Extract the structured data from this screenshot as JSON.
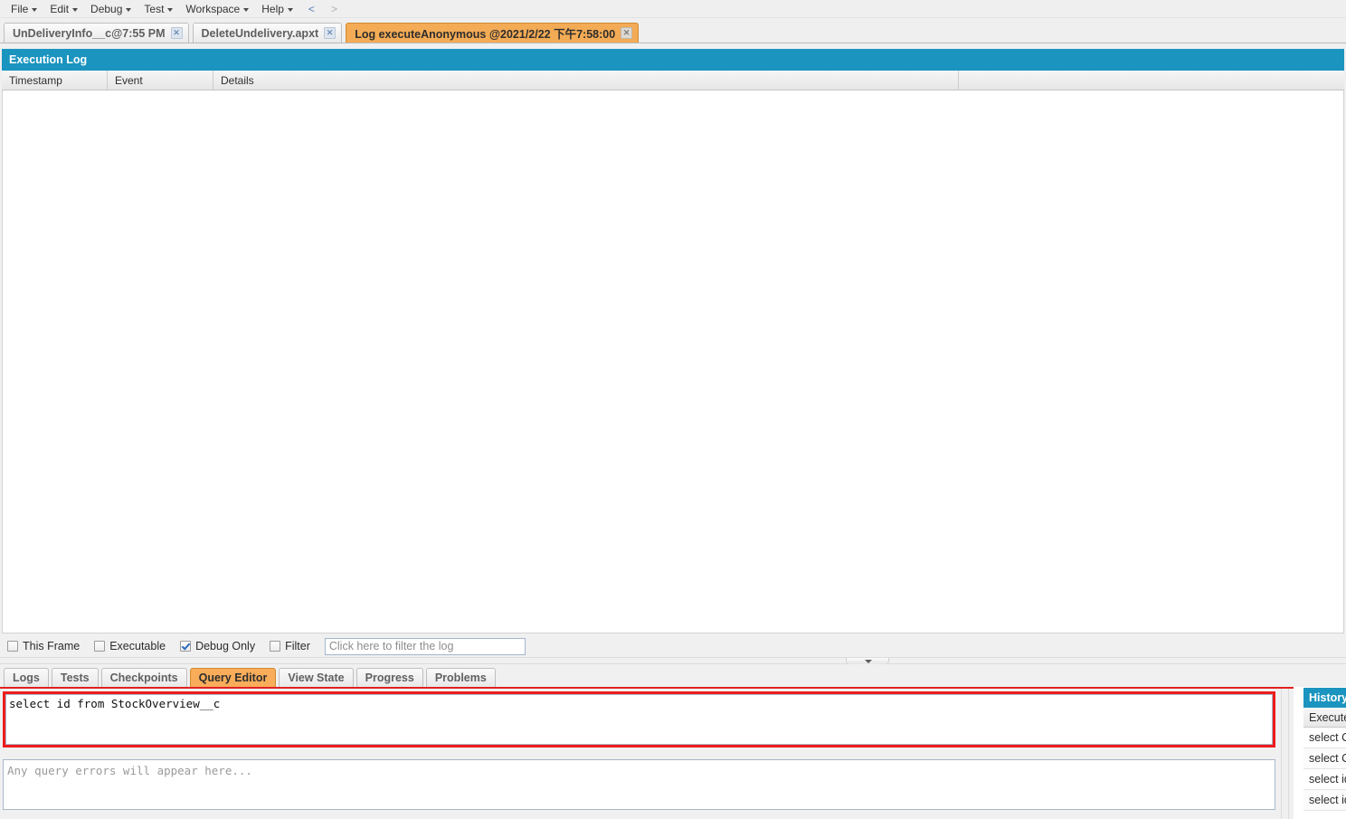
{
  "menu": {
    "items": [
      {
        "label": "File",
        "caret": true
      },
      {
        "label": "Edit",
        "caret": true
      },
      {
        "label": "Debug",
        "caret": true
      },
      {
        "label": "Test",
        "caret": true
      },
      {
        "label": "Workspace",
        "caret": true
      },
      {
        "label": "Help",
        "caret": true
      }
    ],
    "nav_back": "<",
    "nav_forward": ">"
  },
  "doc_tabs": [
    {
      "label": "UnDeliveryInfo__c@7:55 PM",
      "active": false,
      "close": "✕"
    },
    {
      "label": "DeleteUndelivery.apxt",
      "active": false,
      "close": "✕"
    },
    {
      "label": "Log executeAnonymous @2021/2/22 下午7:58:00",
      "active": true,
      "close": "✕"
    }
  ],
  "execution_log": {
    "title": "Execution Log",
    "columns": [
      "Timestamp",
      "Event",
      "Details",
      ""
    ],
    "rows": []
  },
  "filter_bar": {
    "checkboxes": [
      {
        "label": "This Frame",
        "checked": false
      },
      {
        "label": "Executable",
        "checked": false
      },
      {
        "label": "Debug Only",
        "checked": true
      },
      {
        "label": "Filter",
        "checked": false
      }
    ],
    "input_value": "",
    "input_placeholder": "Click here to filter the log"
  },
  "bottom_tabs": [
    {
      "label": "Logs",
      "active": false
    },
    {
      "label": "Tests",
      "active": false
    },
    {
      "label": "Checkpoints",
      "active": false
    },
    {
      "label": "Query Editor",
      "active": true
    },
    {
      "label": "View State",
      "active": false
    },
    {
      "label": "Progress",
      "active": false
    },
    {
      "label": "Problems",
      "active": false
    }
  ],
  "query_editor": {
    "query_value": "select id from StockOverview__c",
    "query_placeholder": "",
    "error_text": "Any query errors will appear here..."
  },
  "history": {
    "title": "History",
    "column_header": "Executed Query",
    "rows": [
      "select COUNT() from StockOverview__c",
      "select COUNT() from StockOverview__c",
      "select id from StockOverview__c",
      "select id from StockOverview__c"
    ]
  },
  "colors": {
    "panel_header": "#1b94bf",
    "active_tab": "#f4ab55",
    "highlight_border": "#ee1c1c"
  }
}
